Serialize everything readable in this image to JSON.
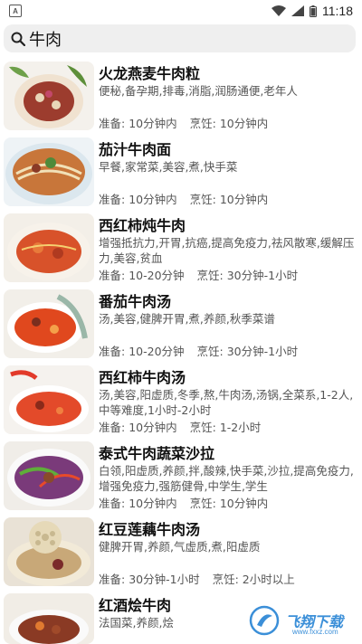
{
  "status": {
    "app_badge": "A",
    "time": "11:18"
  },
  "search": {
    "query": "牛肉"
  },
  "labels": {
    "prep_prefix": "准备:",
    "cook_prefix": "烹饪:"
  },
  "recipes": [
    {
      "title": "火龙燕麦牛肉粒",
      "tags": "便秘,备孕期,排毒,消脂,润肠通便,老年人",
      "prep": "10分钟内",
      "cook": "10分钟内"
    },
    {
      "title": "茄汁牛肉面",
      "tags": "早餐,家常菜,美容,煮,快手菜",
      "prep": "10分钟内",
      "cook": "10分钟内"
    },
    {
      "title": "西红柿炖牛肉",
      "tags": "增强抵抗力,开胃,抗癌,提高免疫力,祛风散寒,缓解压力,美容,贫血",
      "prep": "10-20分钟",
      "cook": "30分钟-1小时"
    },
    {
      "title": "番茄牛肉汤",
      "tags": "汤,美容,健脾开胃,煮,养颜,秋季菜谱",
      "prep": "10-20分钟",
      "cook": "30分钟-1小时"
    },
    {
      "title": "西红柿牛肉汤",
      "tags": "汤,美容,阳虚质,冬季,熬,牛肉汤,汤锅,全菜系,1-2人,中等难度,1小时-2小时",
      "prep": "10分钟内",
      "cook": "1-2小时"
    },
    {
      "title": "泰式牛肉蔬菜沙拉",
      "tags": "白领,阳虚质,养颜,拌,酸辣,快手菜,沙拉,提高免疫力,增强免疫力,强筋健骨,中学生,学生",
      "prep": "10分钟内",
      "cook": "10分钟内"
    },
    {
      "title": "红豆莲藕牛肉汤",
      "tags": "健脾开胃,养颜,气虚质,煮,阳虚质",
      "prep": "30分钟-1小时",
      "cook": "2小时以上"
    },
    {
      "title": "红酒烩牛肉",
      "tags": "法国菜,养颜,烩",
      "prep": "",
      "cook": ""
    }
  ],
  "watermark": {
    "text": "飞翔下载",
    "sub": "www.fxxz.com"
  }
}
